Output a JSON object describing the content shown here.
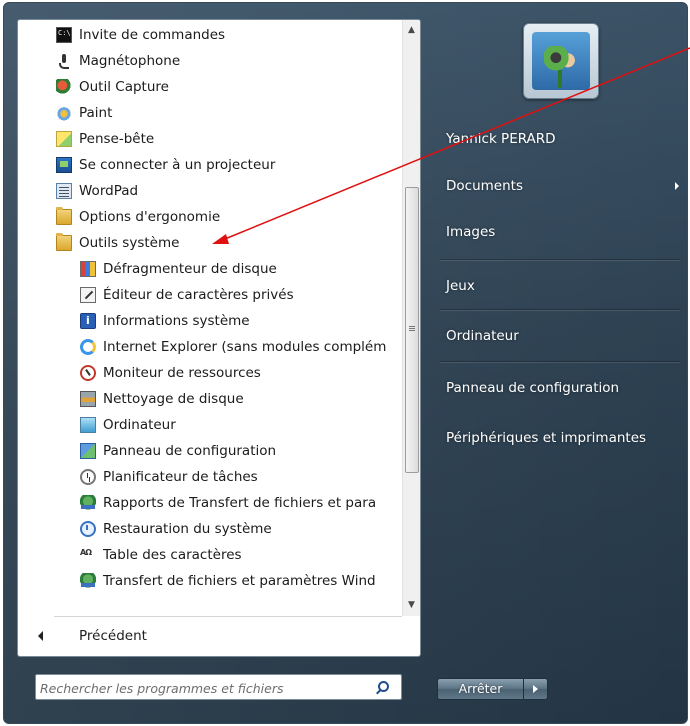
{
  "programs": [
    {
      "label": "Invite de commandes",
      "icon": "cmd-icon"
    },
    {
      "label": "Magnétophone",
      "icon": "microphone-icon"
    },
    {
      "label": "Outil Capture",
      "icon": "snipping-tool-icon"
    },
    {
      "label": "Paint",
      "icon": "paint-icon"
    },
    {
      "label": "Pense-bête",
      "icon": "sticky-notes-icon"
    },
    {
      "label": "Se connecter à un projecteur",
      "icon": "projector-icon"
    },
    {
      "label": "WordPad",
      "icon": "wordpad-icon"
    },
    {
      "label": "Options d'ergonomie",
      "icon": "folder-icon"
    },
    {
      "label": "Outils système",
      "icon": "folder-icon"
    },
    {
      "label": "Défragmenteur de disque",
      "icon": "defrag-icon"
    },
    {
      "label": "Éditeur de caractères privés",
      "icon": "character-editor-icon"
    },
    {
      "label": "Informations système",
      "icon": "system-info-icon"
    },
    {
      "label": "Internet Explorer (sans modules complém",
      "icon": "internet-explorer-icon"
    },
    {
      "label": "Moniteur de ressources",
      "icon": "resource-monitor-icon"
    },
    {
      "label": "Nettoyage de disque",
      "icon": "disk-cleanup-icon"
    },
    {
      "label": "Ordinateur",
      "icon": "computer-icon"
    },
    {
      "label": "Panneau de configuration",
      "icon": "control-panel-icon"
    },
    {
      "label": "Planificateur de tâches",
      "icon": "task-scheduler-icon"
    },
    {
      "label": "Rapports de Transfert de fichiers et para",
      "icon": "easy-transfer-icon"
    },
    {
      "label": "Restauration du système",
      "icon": "system-restore-icon"
    },
    {
      "label": "Table des caractères",
      "icon": "character-map-icon"
    },
    {
      "label": "Transfert de fichiers et paramètres Wind",
      "icon": "easy-transfer-icon"
    }
  ],
  "back_label": "Précédent",
  "search": {
    "placeholder": "Rechercher les programmes et fichiers"
  },
  "right_links": [
    {
      "label": "Yannick PERARD",
      "has_submenu": false
    },
    {
      "label": "Documents",
      "has_submenu": true
    },
    {
      "label": "Images",
      "has_submenu": false
    },
    {
      "label": "Jeux",
      "has_submenu": false
    },
    {
      "label": "Ordinateur",
      "has_submenu": false
    },
    {
      "label": "Panneau de configuration",
      "has_submenu": false
    },
    {
      "label": "Périphériques et imprimantes",
      "has_submenu": false
    }
  ],
  "shutdown_label": "Arrêter",
  "colors": {
    "annotation_arrow": "#e01010",
    "menu_background": "#2d4152"
  }
}
